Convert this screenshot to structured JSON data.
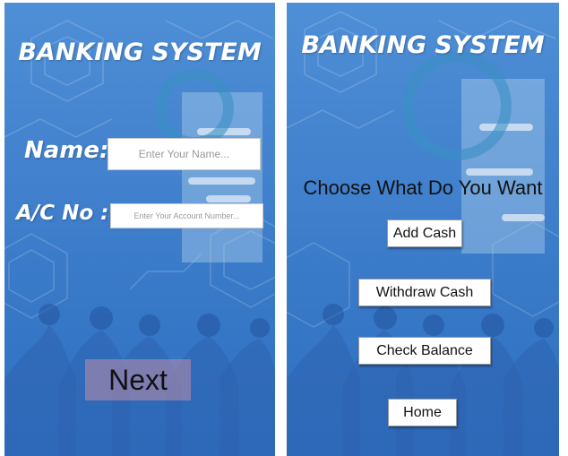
{
  "left_screen": {
    "title": "BANKING SYSTEM",
    "name_label": "Name:",
    "name_placeholder": "Enter Your Name...",
    "account_label": "A/C No :",
    "account_placeholder": "Enter Your Account Number...",
    "next_label": "Next"
  },
  "right_screen": {
    "title": "BANKING SYSTEM",
    "prompt": "Choose What Do You Want",
    "buttons": {
      "add_cash": "Add Cash",
      "withdraw_cash": "Withdraw Cash",
      "check_balance": "Check Balance",
      "home": "Home"
    }
  },
  "colors": {
    "background_blue": "#3f7fcc",
    "next_button": "#be8caa",
    "text_white": "#ffffff"
  }
}
